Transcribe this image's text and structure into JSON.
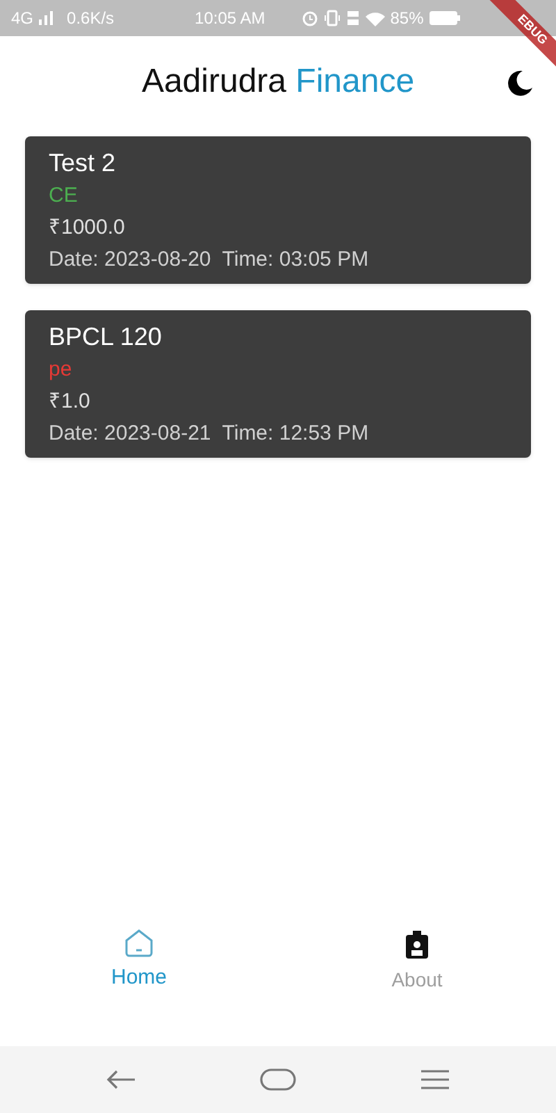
{
  "status_bar": {
    "network": "4G",
    "speed": "0.6K/s",
    "time": "10:05 AM",
    "battery": "85%"
  },
  "debug_banner": "EBUG",
  "app_bar": {
    "title_part_1": "Aadirudra",
    "title_part_2": "Finance"
  },
  "cards": [
    {
      "name": "Test 2",
      "type": "CE",
      "color": "#4caf50",
      "amount": "₹1000.0",
      "date": "Date: 2023-08-20",
      "time": "Time: 03:05 PM"
    },
    {
      "name": "BPCL 120",
      "type": "pe",
      "color": "#e53935",
      "amount": "₹1.0",
      "date": "Date: 2023-08-21",
      "time": "Time: 12:53 PM"
    }
  ],
  "bottom_nav": [
    {
      "label": "Home",
      "kind": "home",
      "selected": true
    },
    {
      "label": "About",
      "kind": "badge",
      "selected": false
    }
  ]
}
